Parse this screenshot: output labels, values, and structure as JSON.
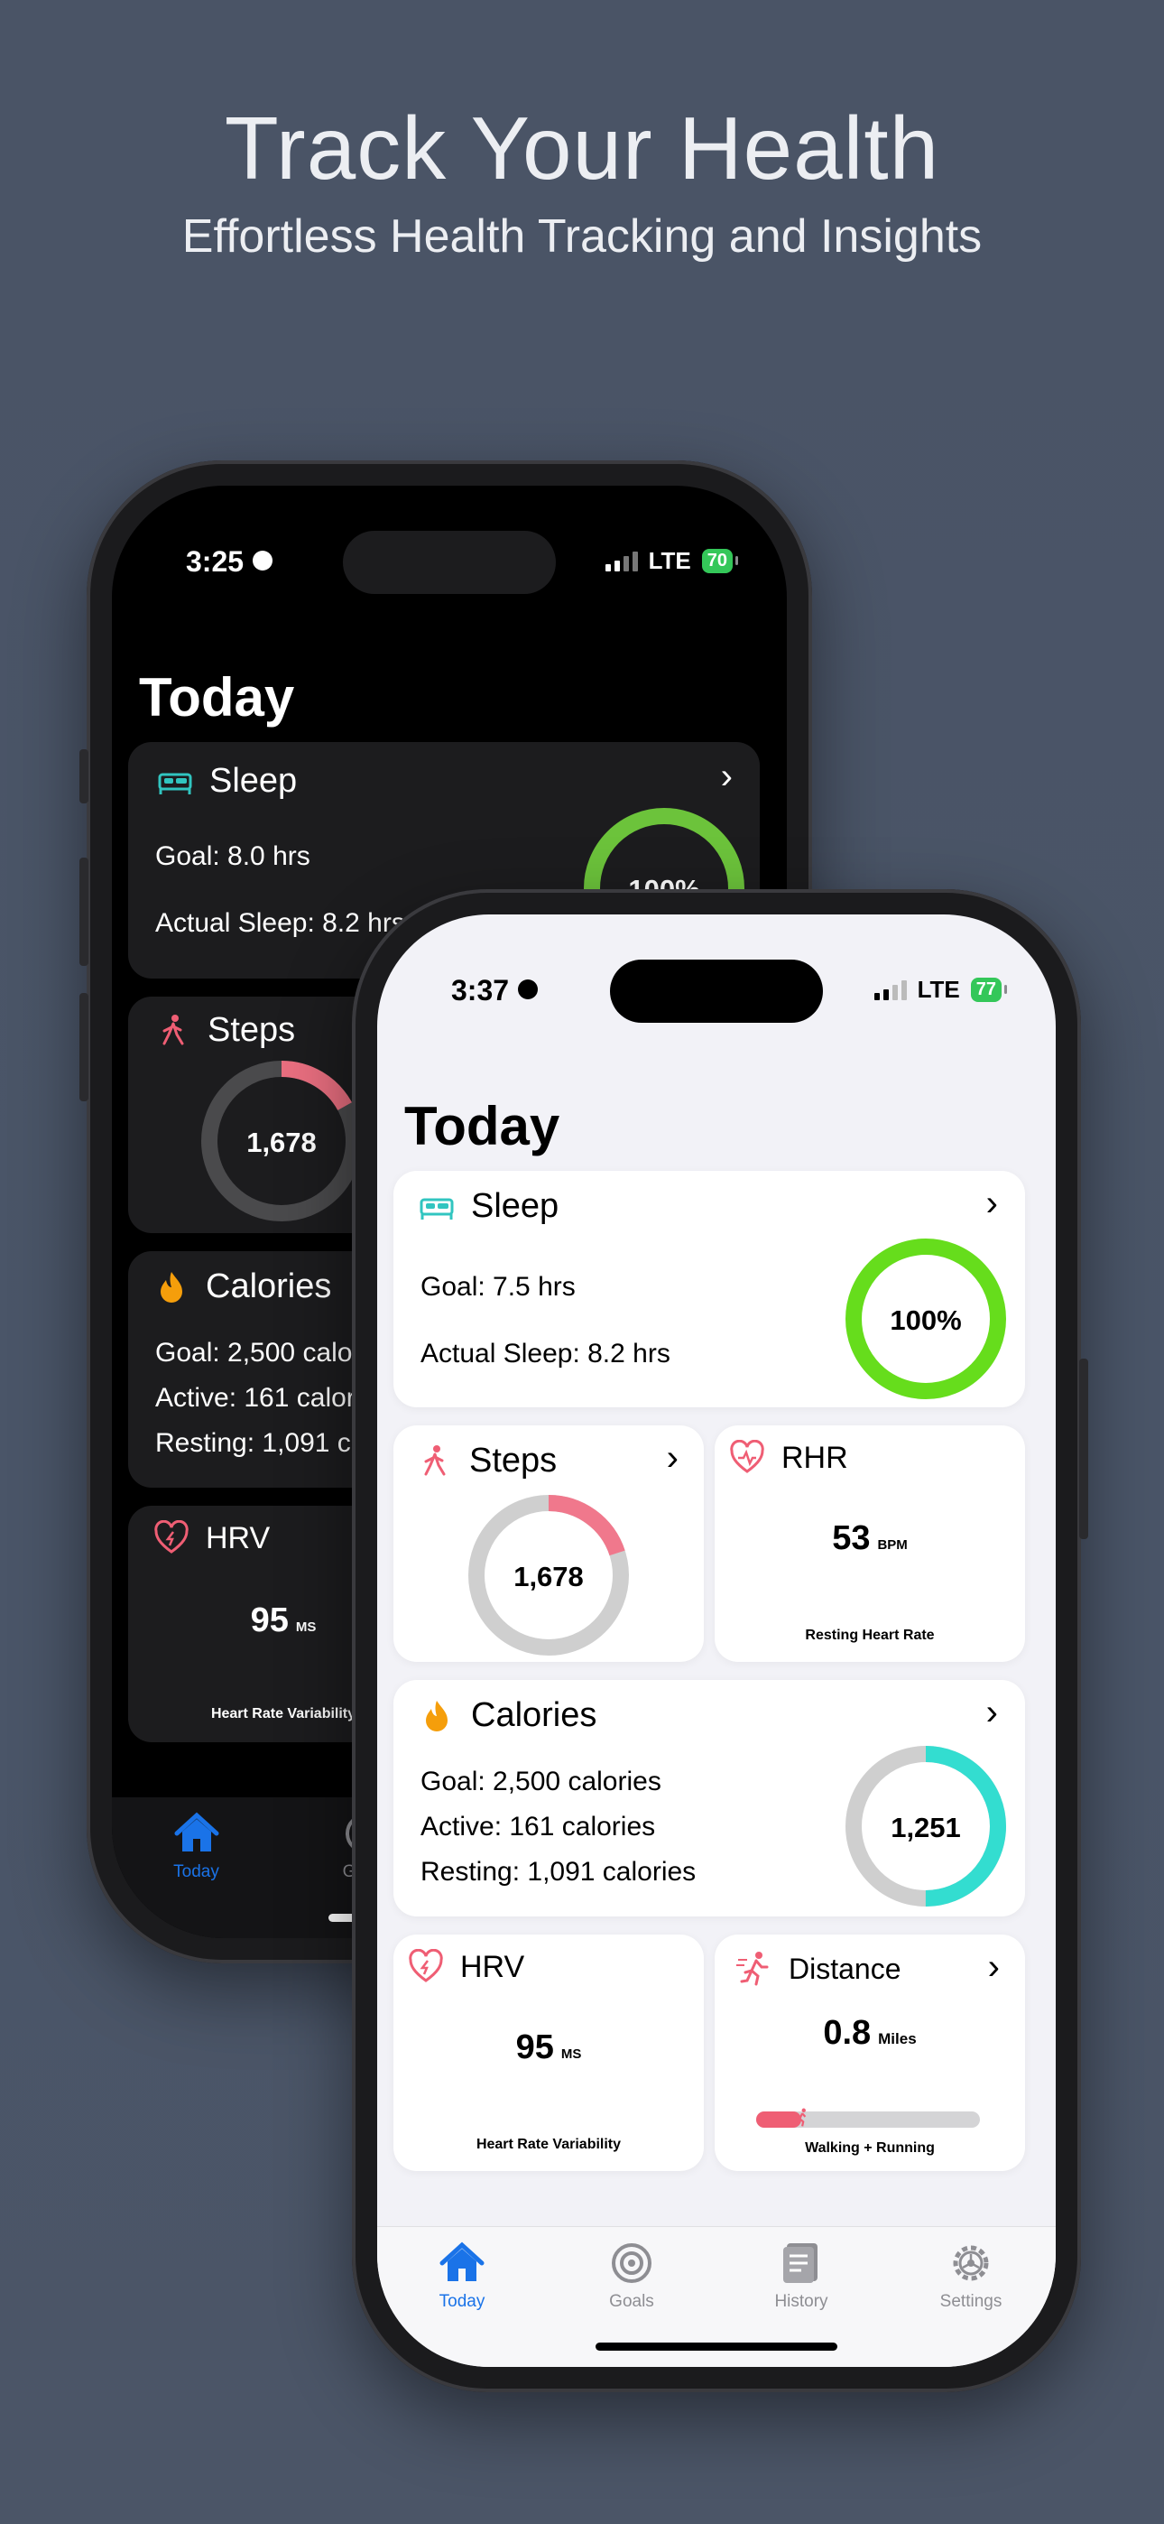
{
  "header": {
    "title": "Track Your Health",
    "subtitle": "Effortless Health Tracking and Insights"
  },
  "colors": {
    "accent_blue": "#1a73e8",
    "sleep_ring": "#6cc33b",
    "sleep_ring_front": "#66dd1c",
    "steps_ring": "#f0788c",
    "calories_ring": "#33ddd0",
    "ring_track": "#cfcfcf",
    "sleep_icon": "#31c5c0",
    "steps_icon": "#ef5e74",
    "calories_icon": "#f59e0b",
    "heart_icon": "#ef5e74"
  },
  "back_phone": {
    "status": {
      "time": "3:25",
      "network": "LTE",
      "battery": "70"
    },
    "title": "Today",
    "sleep": {
      "title": "Sleep",
      "goal": "Goal: 8.0 hrs",
      "actual": "Actual Sleep: 8.2 hrs",
      "percent": "100%",
      "progress": 1.0
    },
    "steps": {
      "title": "Steps",
      "value": "1,678",
      "progress": 0.17
    },
    "calories": {
      "title": "Calories",
      "goal": "Goal: 2,500 calories",
      "active": "Active: 161 calories",
      "resting": "Resting: 1,091 calories"
    },
    "hrv": {
      "title": "HRV",
      "value": "95",
      "unit": "MS",
      "caption": "Heart Rate Variability"
    },
    "tabs": [
      {
        "label": "Today",
        "icon": "house-icon"
      },
      {
        "label": "Goals",
        "icon": "target-icon"
      }
    ]
  },
  "front_phone": {
    "status": {
      "time": "3:37",
      "network": "LTE",
      "battery": "77"
    },
    "title": "Today",
    "sleep": {
      "title": "Sleep",
      "goal": "Goal: 7.5 hrs",
      "actual": "Actual Sleep: 8.2 hrs",
      "percent": "100%",
      "progress": 1.0
    },
    "steps": {
      "title": "Steps",
      "value": "1,678",
      "progress": 0.2
    },
    "rhr": {
      "title": "RHR",
      "value": "53",
      "unit": "BPM",
      "caption": "Resting Heart Rate"
    },
    "calories": {
      "title": "Calories",
      "goal": "Goal: 2,500 calories",
      "active": "Active: 161 calories",
      "resting": "Resting: 1,091 calories",
      "value": "1,251",
      "progress": 0.5
    },
    "hrv": {
      "title": "HRV",
      "value": "95",
      "unit": "MS",
      "caption": "Heart Rate Variability"
    },
    "distance": {
      "title": "Distance",
      "value": "0.8",
      "unit": "Miles",
      "caption": "Walking + Running",
      "progress": 0.2
    },
    "tabs": [
      {
        "label": "Today",
        "icon": "house-icon",
        "active": true
      },
      {
        "label": "Goals",
        "icon": "target-icon"
      },
      {
        "label": "History",
        "icon": "document-icon"
      },
      {
        "label": "Settings",
        "icon": "gear-icon"
      }
    ]
  }
}
